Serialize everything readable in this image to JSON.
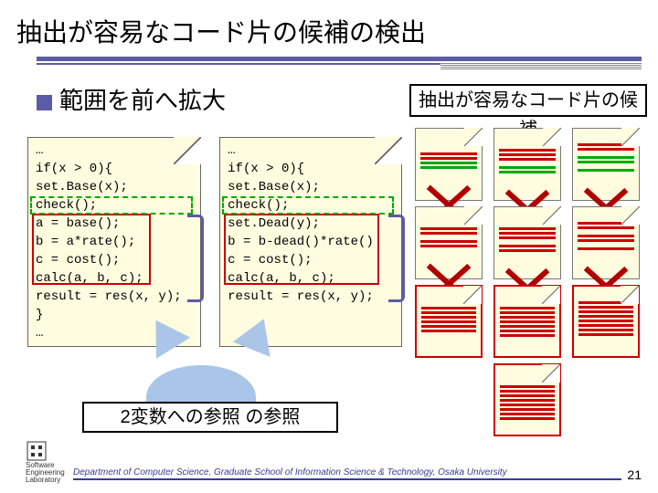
{
  "title": "抽出が容易なコード片の候補の検出",
  "subtitle": "範囲を前へ拡大",
  "rbox": "抽出が容易なコード片の候補",
  "code_left": [
    "…",
    "if(x > 0){",
    " set.Base(x);",
    " check();",
    " a = base();",
    " b = a*rate();",
    " c = cost();",
    " calc(a, b, c);",
    " result = res(x, y);",
    "}",
    "…"
  ],
  "code_right": [
    "…",
    "if(x > 0){",
    " set.Base(x);",
    " check();",
    " set.Dead(y);",
    " b = b-dead()*rate()",
    " c = cost();",
    " calc(a, b, c);",
    " result = res(x, y);"
  ],
  "caption_a": "2変数への参照",
  "caption_b": "の参照",
  "footer": "Department of Computer Science, Graduate School of Information Science & Technology, Osaka University",
  "logo_text1": "Software",
  "logo_text2": "Engineering",
  "logo_text3": "Laboratory",
  "page": "21"
}
